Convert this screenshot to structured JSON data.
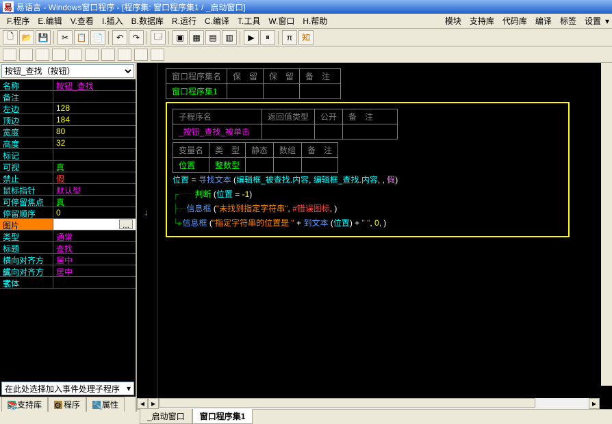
{
  "title": "易语言 - Windows窗口程序 - [程序集: 窗口程序集1 / _启动窗口]",
  "menu": {
    "program": "F.程序",
    "edit": "E.编辑",
    "view": "V.查看",
    "insert": "I.插入",
    "database": "B.数据库",
    "run": "R.运行",
    "compile": "C.编译",
    "tools": "T.工具",
    "window": "W.窗口",
    "help": "H.帮助",
    "module": "模块",
    "support": "支持库",
    "codebase": "代码库",
    "compile2": "编译",
    "tags": "标签",
    "settings": "设置"
  },
  "selector": "按钮_查找（按钮）",
  "props": [
    {
      "name": "名称",
      "value": "按钮_查找",
      "vclass": "c-magenta"
    },
    {
      "name": "备注",
      "value": ""
    },
    {
      "name": "左边",
      "value": "128",
      "vclass": "c-yellow"
    },
    {
      "name": "顶边",
      "value": "184",
      "vclass": "c-yellow"
    },
    {
      "name": "宽度",
      "value": "80",
      "vclass": "c-yellow"
    },
    {
      "name": "高度",
      "value": "32",
      "vclass": "c-yellow"
    },
    {
      "name": "标记",
      "value": ""
    },
    {
      "name": "可视",
      "value": "真",
      "vclass": "c-green"
    },
    {
      "name": "禁止",
      "value": "假",
      "vclass": "c-red"
    },
    {
      "name": "鼠标指针",
      "value": "默认型",
      "vclass": "c-magenta"
    },
    {
      "name": "可停留焦点",
      "value": "真",
      "vclass": "c-green"
    },
    {
      "name": "  停留顺序",
      "value": "0",
      "vclass": "c-yellow"
    },
    {
      "name": "图片",
      "value": "",
      "selected": true
    },
    {
      "name": "类型",
      "value": "通常",
      "vclass": "c-magenta"
    },
    {
      "name": "标题",
      "value": "查找",
      "vclass": "c-magenta"
    },
    {
      "name": "横向对齐方式",
      "value": "居中",
      "vclass": "c-magenta"
    },
    {
      "name": "纵向对齐方式",
      "value": "居中",
      "vclass": "c-magenta"
    },
    {
      "name": "字体",
      "value": ""
    }
  ],
  "bot_selector": "在此处选择加入事件处理子程序",
  "left_tabs": {
    "support": "支持库",
    "program": "程序",
    "props": "属性"
  },
  "header_table": {
    "h1": "窗口程序集名",
    "h2": "保　留",
    "h3": "保　留",
    "h4": "备　注",
    "v1": "窗口程序集1"
  },
  "sub_table": {
    "h1": "子程序名",
    "h2": "返回值类型",
    "h3": "公开",
    "h4": "备　注",
    "v1": "_按钮_查找_被单击"
  },
  "var_table": {
    "h1": "变量名",
    "h2": "类　型",
    "h3": "静态",
    "h4": "数组",
    "h5": "备　注",
    "v1": "位置",
    "v2": "整数型"
  },
  "code": {
    "l1a": "位置",
    "l1b": " = ",
    "l1c": "寻找文本",
    "l1d": " (",
    "l1e": "编辑框_被查找",
    "l1f": ".",
    "l1g": "内容",
    "l1h": ", ",
    "l1i": "编辑框_查找",
    "l1j": ".",
    "l1k": "内容",
    "l1l": ", , ",
    "l1m": "假",
    "l1n": ")",
    "l2a": "判断",
    "l2b": " (",
    "l2c": "位置",
    "l2d": " = ",
    "l2e": "-1",
    "l2f": ")",
    "l3a": "信息框",
    "l3b": " (",
    "l3c": "\"未找到指定字符串\"",
    "l3d": ", ",
    "l3e": "#错误图标",
    "l3f": ", )",
    "l4a": "信息框",
    "l4b": " (",
    "l4c": "\"指定字符串的位置是 \"",
    "l4d": " + ",
    "l4e": "到文本",
    "l4f": " (",
    "l4g": "位置",
    "l4h": ")",
    "l4i": " + ",
    "l4j": "\" \"",
    "l4k": ", ",
    "l4l": "0",
    "l4m": ", )"
  },
  "bottom_tabs": {
    "t1": "_启动窗口",
    "t2": "窗口程序集1"
  }
}
